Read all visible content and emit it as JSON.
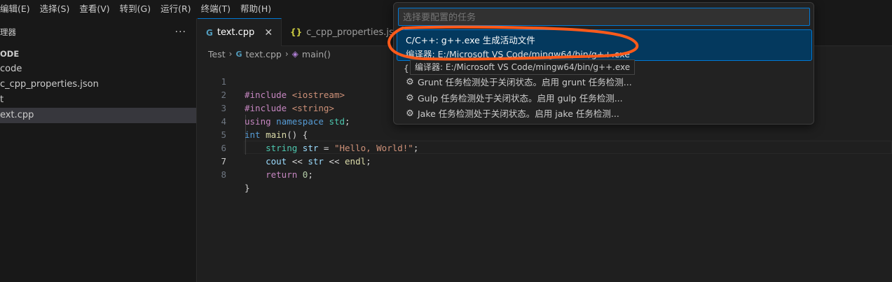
{
  "menu": [
    "编辑(E)",
    "选择(S)",
    "查看(V)",
    "转到(G)",
    "运行(R)",
    "终端(T)",
    "帮助(H)"
  ],
  "sidebar": {
    "title": "理器",
    "more": "···",
    "items": [
      {
        "label": "ODE"
      },
      {
        "label": "code"
      },
      {
        "label": "c_cpp_properties.json"
      },
      {
        "label": "t"
      },
      {
        "label": "ext.cpp"
      }
    ]
  },
  "tabs": [
    {
      "icon": "G",
      "label": "text.cpp",
      "close": "✕"
    },
    {
      "icon": "{}",
      "label": "c_cpp_properties.json"
    }
  ],
  "breadcrumb": {
    "folder": "Test",
    "file_icon": "G",
    "file": "text.cpp",
    "symbol": "main()"
  },
  "editor": {
    "line_numbers": [
      "1",
      "2",
      "3",
      "4",
      "5",
      "6",
      "7",
      "8"
    ],
    "current_line": "7"
  },
  "quickpick": {
    "placeholder": "选择要配置的任务",
    "selected_label": "C/C++: g++.exe 生成活动文件",
    "selected_detail": "编译器: E:/Microsoft VS Code/mingw64/bin/g++.exe",
    "brace": "{",
    "items": [
      "Grunt 任务检测处于关闭状态。启用 grunt 任务检测...",
      "Gulp 任务检测处于关闭状态。启用 gulp 任务检测...",
      "Jake 任务检测处于关闭状态。启用 jake 任务检测..."
    ]
  },
  "tooltip": "编译器: E:/Microsoft VS Code/mingw64/bin/g++.exe",
  "colors": {
    "annotation": "#ff5a1a",
    "accent": "#0078d4",
    "selection": "#04395e"
  },
  "icons": [
    "gear-icon",
    "cpp-file-icon",
    "json-file-icon",
    "symbol-method-icon",
    "close-icon",
    "chevron-right-icon"
  ]
}
